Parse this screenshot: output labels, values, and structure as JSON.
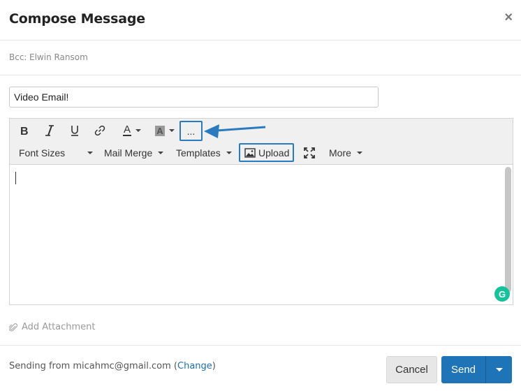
{
  "dialog": {
    "title": "Compose Message"
  },
  "bcc": {
    "label": "Bcc:",
    "value": "Elwin Ransom"
  },
  "subject": {
    "value": "Video Email!"
  },
  "toolbar": {
    "row1": [
      "bold-icon",
      "italic-icon",
      "underline-icon",
      "link-icon",
      "font-color-icon",
      "highlight-color-icon",
      "more-formatting-icon"
    ],
    "more_label": "...",
    "font_sizes": "Font Sizes",
    "mail_merge": "Mail Merge",
    "templates": "Templates",
    "upload": "Upload",
    "more": "More",
    "font_color_letter": "A",
    "highlight_letter": "A"
  },
  "attachment": {
    "label": "Add Attachment"
  },
  "footer": {
    "sending_prefix": "Sending from micahmc@gmail.com (",
    "change_link": "Change",
    "sending_suffix": ")",
    "cancel": "Cancel",
    "send": "Send"
  },
  "colors": {
    "accent": "#1f73b7",
    "annotation": "#2a7ac0",
    "grammarly": "#15c39a"
  },
  "grammarly_letter": "G"
}
